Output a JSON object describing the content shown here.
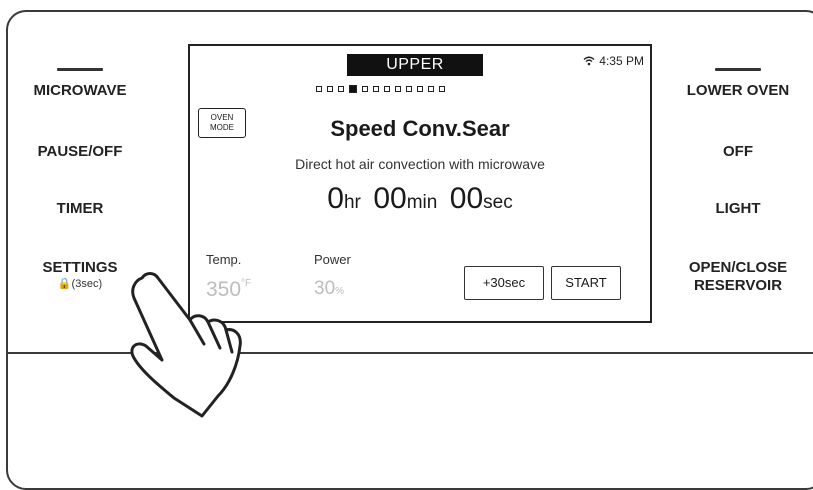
{
  "left_buttons": {
    "microwave": "MICROWAVE",
    "pause_off": "PAUSE/OFF",
    "timer": "TIMER",
    "settings": "SETTINGS",
    "settings_hint": "🔒(3sec)"
  },
  "right_buttons": {
    "lower_oven": "LOWER OVEN",
    "off": "OFF",
    "light": "LIGHT",
    "open_close_line1": "OPEN/CLOSE",
    "open_close_line2": "RESERVOIR"
  },
  "screen": {
    "tab": "UPPER",
    "clock": "4:35 PM",
    "oven_mode_label": "OVEN\nMODE",
    "mode_title": "Speed Conv.Sear",
    "mode_description": "Direct hot air convection with microwave",
    "time": {
      "hr_value": "0",
      "hr_unit": "hr",
      "min_value": "00",
      "min_unit": "min",
      "sec_value": "00",
      "sec_unit": "sec"
    },
    "temp_label": "Temp.",
    "temp_value": "350",
    "temp_unit": "°F",
    "power_label": "Power",
    "power_value": "30",
    "power_unit": "%",
    "add_time_label": "+30sec",
    "start_label": "START",
    "page_dots": {
      "total": 12,
      "active_index": 3
    }
  },
  "icons": [
    "wifi-icon",
    "lock-icon",
    "hand-pointer-icon"
  ]
}
